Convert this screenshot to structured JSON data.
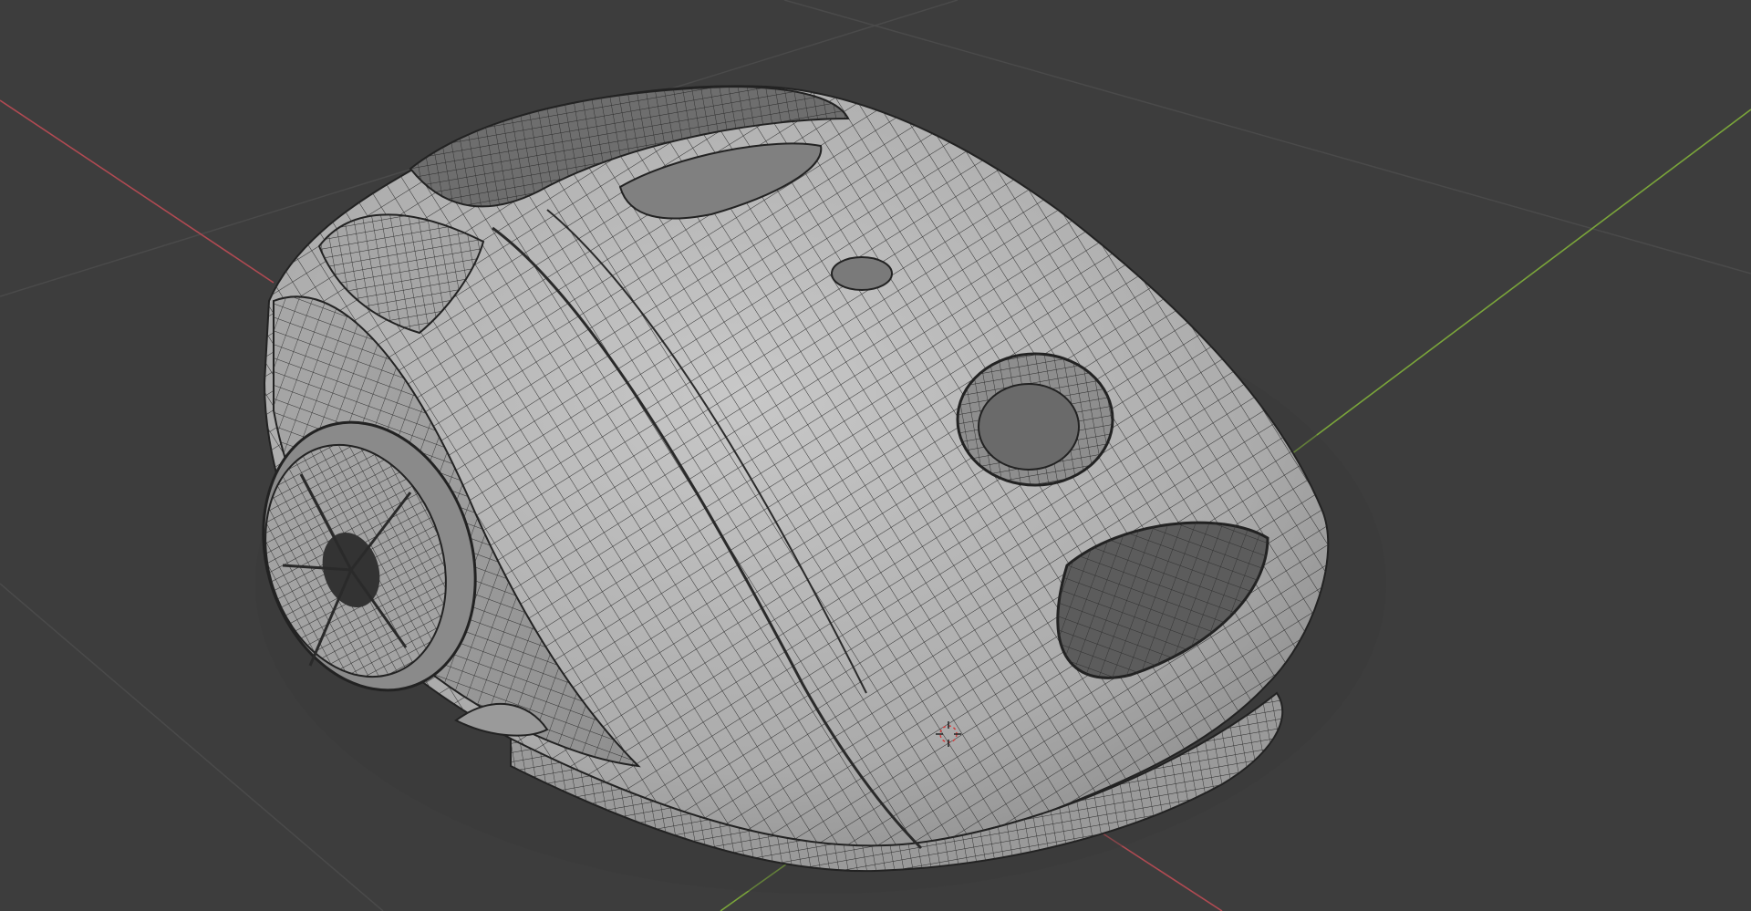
{
  "app": "Blender",
  "viewport": {
    "mode": "solid-wireframe",
    "background_color": "#3d3d3d",
    "grid_color": "#4a4a4a",
    "x_axis_color": "#b04a52",
    "y_axis_color": "#7aa53a",
    "model": {
      "name": "vacuum-cleaner",
      "shell_color": "#b9b9b9",
      "shadow_color": "#8c8c8c",
      "wire_color": "#2e2e2e"
    },
    "cursor_icon": "3d-cursor-icon"
  }
}
